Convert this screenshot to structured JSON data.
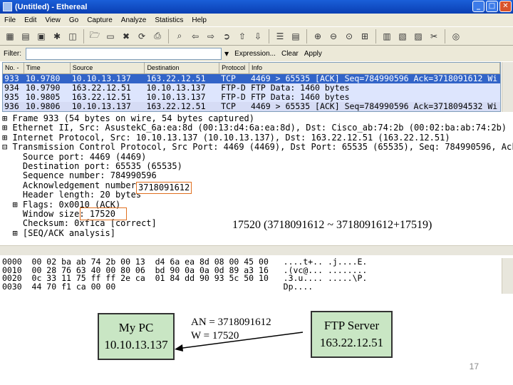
{
  "window": {
    "title": "(Untitled) - Ethereal"
  },
  "menu": [
    "File",
    "Edit",
    "View",
    "Go",
    "Capture",
    "Analyze",
    "Statistics",
    "Help"
  ],
  "filter": {
    "label": "Filter:",
    "expression_label": "Expression...",
    "clear_label": "Clear",
    "apply_label": "Apply"
  },
  "packet_list": {
    "headers": [
      "No. -",
      "Time",
      "Source",
      "Destination",
      "Protocol",
      "Info"
    ],
    "rows": [
      {
        "no": "933",
        "time": "10.9780",
        "src": "10.10.13.137",
        "dst": "163.22.12.51",
        "proto": "TCP",
        "info": "4469 > 65535 [ACK] Seq=784990596 Ack=3718091612 Wi"
      },
      {
        "no": "934",
        "time": "10.9790",
        "src": "163.22.12.51",
        "dst": "10.10.13.137",
        "proto": "FTP-D",
        "info": "FTP Data: 1460 bytes"
      },
      {
        "no": "935",
        "time": "10.9805",
        "src": "163.22.12.51",
        "dst": "10.10.13.137",
        "proto": "FTP-D",
        "info": "FTP Data: 1460 bytes"
      },
      {
        "no": "936",
        "time": "10.9806",
        "src": "10.10.13.137",
        "dst": "163.22.12.51",
        "proto": "TCP",
        "info": "4469 > 65535 [ACK] Seq=784990596 Ack=3718094532 Wi"
      }
    ]
  },
  "details": {
    "lines": [
      "⊞ Frame 933 (54 bytes on wire, 54 bytes captured)",
      "⊞ Ethernet II, Src: AsustekC_6a:ea:8d (00:13:d4:6a:ea:8d), Dst: Cisco_ab:74:2b (00:02:ba:ab:74:2b)",
      "⊞ Internet Protocol, Src: 10.10.13.137 (10.10.13.137), Dst: 163.22.12.51 (163.22.12.51)",
      "⊟ Transmission Control Protocol, Src Port: 4469 (4469), Dst Port: 65535 (65535), Seq: 784990596, Ack:",
      "    Source port: 4469 (4469)",
      "    Destination port: 65535 (65535)",
      "    Sequence number: 784990596",
      "    Acknowledgement number:",
      "    Header length: 20 bytes",
      "  ⊞ Flags: 0x0010 (ACK)",
      "    Window size: 17520",
      "    Checksum: 0xf1ca [correct]",
      "  ⊞ [SEQ/ACK analysis]"
    ],
    "ack_value": "3718091612",
    "callout": "17520 (3718091612 ~ 3718091612+17519)"
  },
  "bytes": {
    "lines": [
      "0000  00 02 ba ab 74 2b 00 13  d4 6a ea 8d 08 00 45 00   ....t+.. .j....E.",
      "0010  00 28 76 63 40 00 80 06  bd 90 0a 0a 0d 89 a3 16   .(vc@... ........",
      "0020  0c 33 11 75 ff ff 2e ca  01 84 dd 90 93 5c 50 10   .3.u.... .....\\P.",
      "0030  44 70 f1 ca 00 00                                  Dp...."
    ]
  },
  "diagram": {
    "pc_name": "My PC",
    "pc_ip": "10.10.13.137",
    "an_label": "AN = 3718091612",
    "w_label": "W = 17520",
    "server_name": "FTP Server",
    "server_ip": "163.22.12.51"
  },
  "page_number": "17"
}
